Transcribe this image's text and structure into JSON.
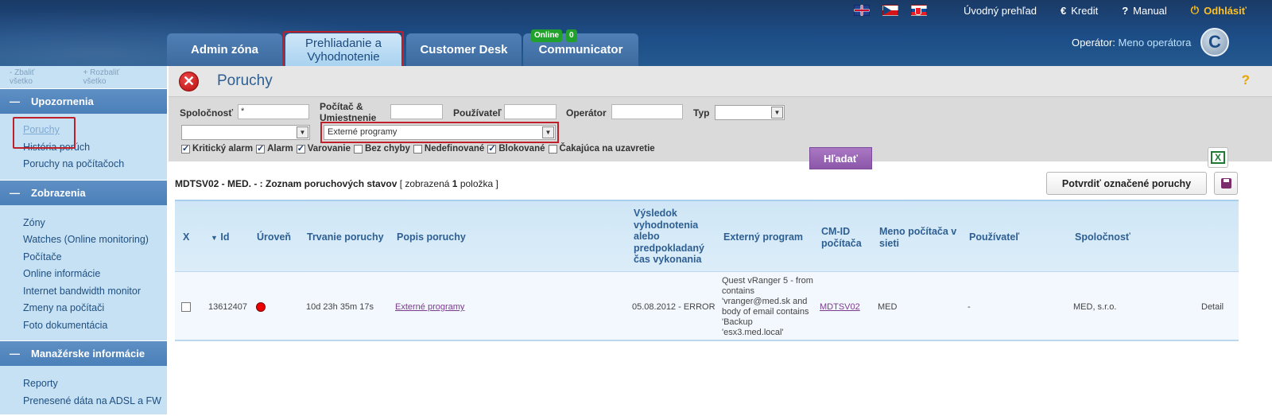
{
  "topbar": {
    "flags": [
      "flag-uk",
      "flag-cz",
      "flag-sk"
    ],
    "overview": "Úvodný prehľad",
    "credit": "Kredit",
    "manual": "Manual",
    "logout": "Odhlásiť"
  },
  "tabs": [
    {
      "label": "Admin zóna"
    },
    {
      "label": "Prehliadanie a Vyhodnotenie"
    },
    {
      "label": "Customer Desk"
    },
    {
      "label": "Communicator",
      "badge_online": "Online",
      "badge_count": "0"
    }
  ],
  "operator": {
    "label": "Operátor:",
    "name": "Meno operátora"
  },
  "logo": "C",
  "sidebar": {
    "collapse_all": "Zbaliť všetko",
    "expand_all": "Rozbaliť všetko",
    "sections": [
      {
        "title": "Upozornenia",
        "items": [
          "Poruchy",
          "História porúch",
          "Poruchy na počítačoch"
        ]
      },
      {
        "title": "Zobrazenia",
        "items": [
          "Zóny",
          "Watches (Online monitoring)",
          "Počítače",
          "Online informácie",
          "Internet bandwidth monitor",
          "Zmeny na počítači",
          "Foto dokumentácia"
        ]
      },
      {
        "title": "Manažérske informácie",
        "items": [
          "Reporty",
          "Prenesené dáta na ADSL a FW"
        ]
      }
    ]
  },
  "page": {
    "title": "Poruchy",
    "help": "?"
  },
  "filters": {
    "company_label": "Spoločnosť",
    "company_value": "*",
    "computer_label": "Počítač & Umiestnenie",
    "computer_value": "",
    "user_label": "Používateľ",
    "user_value": "",
    "operator_label": "Operátor",
    "operator_value": "",
    "type_label": "Typ",
    "type_value": "",
    "select1_value": "",
    "select2_value": "Externé programy",
    "search_button": "Hľadať",
    "checkboxes": [
      {
        "label": "Kritický alarm",
        "checked": true
      },
      {
        "label": "Alarm",
        "checked": true
      },
      {
        "label": "Varovanie",
        "checked": true
      },
      {
        "label": "Bez chyby",
        "checked": false
      },
      {
        "label": "Nedefinované",
        "checked": false
      },
      {
        "label": "Blokované",
        "checked": true
      },
      {
        "label": "Čakajúca na uzavretie",
        "checked": false
      }
    ]
  },
  "list": {
    "prefix": "MDTSV02 - MED. - : Zoznam poruchových stavov",
    "shown_label": "[ zobrazená",
    "count": "1",
    "suffix": "položka ]",
    "confirm_button": "Potvrdiť označené poruchy"
  },
  "columns": {
    "x": "X",
    "id": "Id",
    "level": "Úroveň",
    "duration": "Trvanie poruchy",
    "desc": "Popis poruchy",
    "result": "Výsledok vyhodnotenia alebo predpokladaný čas vykonania",
    "external": "Externý program",
    "cmid": "CM-ID počítača",
    "netname": "Meno počítača v sieti",
    "user": "Používateľ",
    "company": "Spoločnosť"
  },
  "rows": [
    {
      "id": "13612407",
      "level_color": "#e00000",
      "duration": "10d 23h 35m 17s",
      "desc": "Externé programy",
      "result": "05.08.2012 - ERROR",
      "external": "Quest vRanger 5 - from contains 'vranger@med.sk and body of email contains 'Backup 'esx3.med.local'",
      "cmid": "MDTSV02",
      "netname": "MED",
      "user": "-",
      "company": "MED, s.r.o.",
      "detail": "Detail"
    }
  ]
}
